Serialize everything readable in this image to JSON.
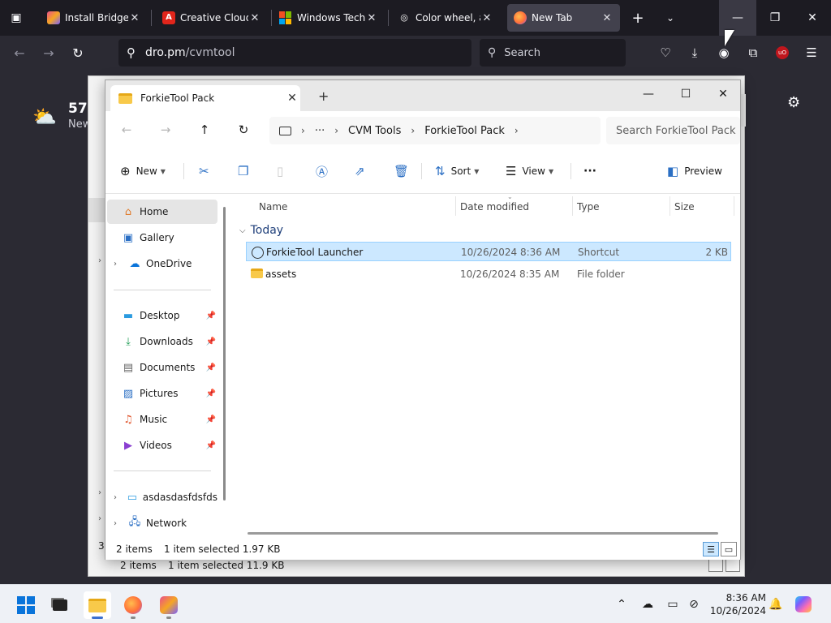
{
  "browser": {
    "tabs": [
      {
        "title": "Install Bridge | A",
        "favicon_color": "#c04f9b"
      },
      {
        "title": "Creative Cloud: I",
        "favicon_color": "#e1251b"
      },
      {
        "title": "Windows Techn",
        "favicon_color": "#f25022"
      },
      {
        "title": "Color wheel, a c",
        "favicon_color": "#111111"
      },
      {
        "title": "New Tab",
        "favicon_color": "#ff7139",
        "active": true
      }
    ],
    "url_host": "dro.pm",
    "url_path": "/cvmtool",
    "search_placeholder": "Search",
    "accent": "#42414d"
  },
  "newtab": {
    "weather_temp": "57°",
    "weather_sub": "New"
  },
  "bg_window": {
    "status_count": "2 items",
    "status_selection": "1 item selected  11.9 KB",
    "partial_left_char": "3"
  },
  "explorer": {
    "tab_title": "ForkieTool Pack",
    "breadcrumb": [
      "CVM Tools",
      "ForkieTool Pack"
    ],
    "breadcrumb_more": "···",
    "search_placeholder": "Search ForkieTool Pack",
    "commands": {
      "new": "New",
      "sort": "Sort",
      "view": "View",
      "more": "···",
      "preview": "Preview"
    },
    "nav": {
      "home": "Home",
      "gallery": "Gallery",
      "onedrive": "OneDrive",
      "desktop": "Desktop",
      "downloads": "Downloads",
      "documents": "Documents",
      "pictures": "Pictures",
      "music": "Music",
      "videos": "Videos",
      "pc": "asdasdasfdsfds",
      "network": "Network"
    },
    "columns": {
      "name": "Name",
      "date": "Date modified",
      "type": "Type",
      "size": "Size"
    },
    "group": "Today",
    "files": [
      {
        "name": "ForkieTool Launcher",
        "date": "10/26/2024 8:36 AM",
        "type": "Shortcut",
        "size": "2 KB",
        "selected": true
      },
      {
        "name": "assets",
        "date": "10/26/2024 8:35 AM",
        "type": "File folder",
        "size": ""
      }
    ],
    "status_count": "2 items",
    "status_selection": "1 item selected  1.97 KB",
    "selection_color": "#cce8ff"
  },
  "taskbar": {
    "time": "8:36 AM",
    "date": "10/26/2024"
  }
}
